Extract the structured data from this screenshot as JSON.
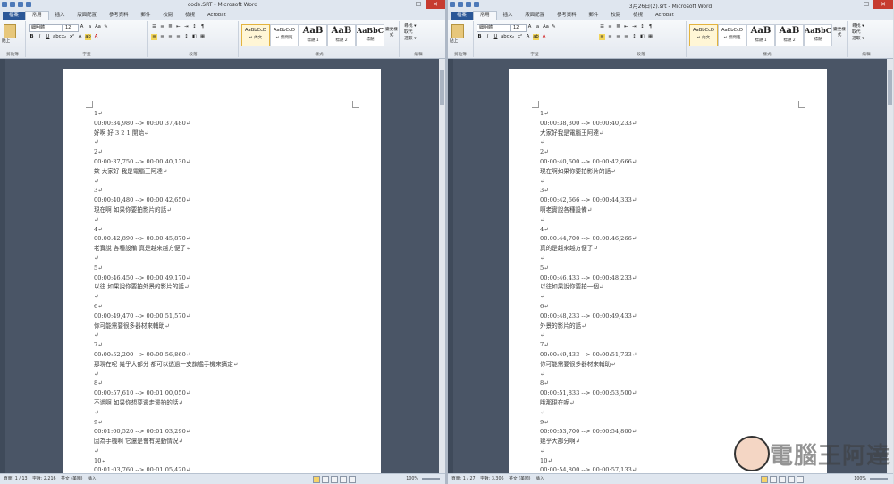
{
  "ribbon": {
    "file_tab": "檔案",
    "tabs": [
      "常用",
      "插入",
      "版面配置",
      "參考資料",
      "郵件",
      "校閱",
      "檢視",
      "Acrobat"
    ],
    "font_name": "細明體",
    "font_size": "12",
    "paste": "貼上",
    "group_labels": [
      "剪貼簿",
      "字型",
      "段落",
      "樣式",
      "編輯"
    ],
    "styles": [
      {
        "sample": "AaBbCcD",
        "name": "↵ 內文"
      },
      {
        "sample": "AaBbCcD",
        "name": "↵ 無間距"
      },
      {
        "sample": "AaB",
        "name": "標題 1"
      },
      {
        "sample": "AaB",
        "name": "標題 2"
      },
      {
        "sample": "AaBbC",
        "name": "標題"
      }
    ],
    "change_styles": "變更樣式",
    "edit_items": [
      "尋找 ▾",
      "取代",
      "選取 ▾"
    ]
  },
  "left": {
    "title": "code.SRT - Microsoft Word",
    "status": {
      "page": "頁面: 1 / 13",
      "words": "字數: 2,216",
      "lang": "英文 (美國)",
      "mode": "插入",
      "zoom": "100%"
    },
    "lines": [
      "1↵",
      "00:00:34,980 --> 00:00:37,480↵",
      "好啊  好  3  2  1  開始↵",
      "↵",
      "2↵",
      "00:00:37,750 --> 00:00:40,130↵",
      "欸  大家好  我是電腦王阿達↵",
      "↵",
      "3↵",
      "00:00:40,480 --> 00:00:42,650↵",
      "現在啊  如果你要拍影片的話↵",
      "↵",
      "4↵",
      "00:00:42,890 --> 00:00:45,870↵",
      "老實說  各種設備  真是越來越方便了↵",
      "↵",
      "5↵",
      "00:00:46,450 --> 00:00:49,170↵",
      "以往  如果說你要拍外景的影片的話↵",
      "↵",
      "6↵",
      "00:00:49,470 --> 00:00:51,570↵",
      "你可能需要很多器材來輔助↵",
      "↵",
      "7↵",
      "00:00:52,200 --> 00:00:56,860↵",
      "那現在呢  幾乎大部分  都可以透過一支旗艦手機來搞定↵",
      "↵",
      "8↵",
      "00:00:57,610 --> 00:01:00,050↵",
      "不過啊  如果你想要邊走邊拍的話↵",
      "↵",
      "9↵",
      "00:01:00,520 --> 00:01:03,290↵",
      "因為手機啊  它還是會有晃動情況↵",
      "↵",
      "10↵",
      "00:01:03,760 --> 00:01:05,420↵"
    ]
  },
  "right": {
    "title": "3月26日(2).srt - Microsoft Word",
    "status": {
      "page": "頁面: 1 / 27",
      "words": "字數: 3,306",
      "lang": "英文 (美國)",
      "mode": "插入",
      "zoom": "100%"
    },
    "lines": [
      "1↵",
      "00:00:38,300 --> 00:00:40,233↵",
      "大家好我是電腦王阿達↵",
      "↵",
      "2↵",
      "00:00:40,600 --> 00:00:42,666↵",
      "現在啊如果你要拍影片的話↵",
      "↵",
      "3↵",
      "00:00:42,666 --> 00:00:44,333↵",
      "啊老實說各種設備↵",
      "↵",
      "4↵",
      "00:00:44,700 --> 00:00:46,266↵",
      "真的是越來越方便了↵",
      "↵",
      "5↵",
      "00:00:46,433 --> 00:00:48,233↵",
      "以往如果說你要拍一個↵",
      "↵",
      "6↵",
      "00:00:48,233 --> 00:00:49,433↵",
      "外景的影片的話↵",
      "↵",
      "7↵",
      "00:00:49,433 --> 00:00:51,733↵",
      "你可能需要很多器材來輔助↵",
      "↵",
      "8↵",
      "00:00:51,833 --> 00:00:53,500↵",
      "哦那現在呢↵",
      "↵",
      "9↵",
      "00:00:53,700 --> 00:00:54,800↵",
      "幾乎大部分啊↵",
      "↵",
      "10↵",
      "00:00:54,800 --> 00:00:57,133↵"
    ]
  },
  "watermark": "電腦王阿達"
}
